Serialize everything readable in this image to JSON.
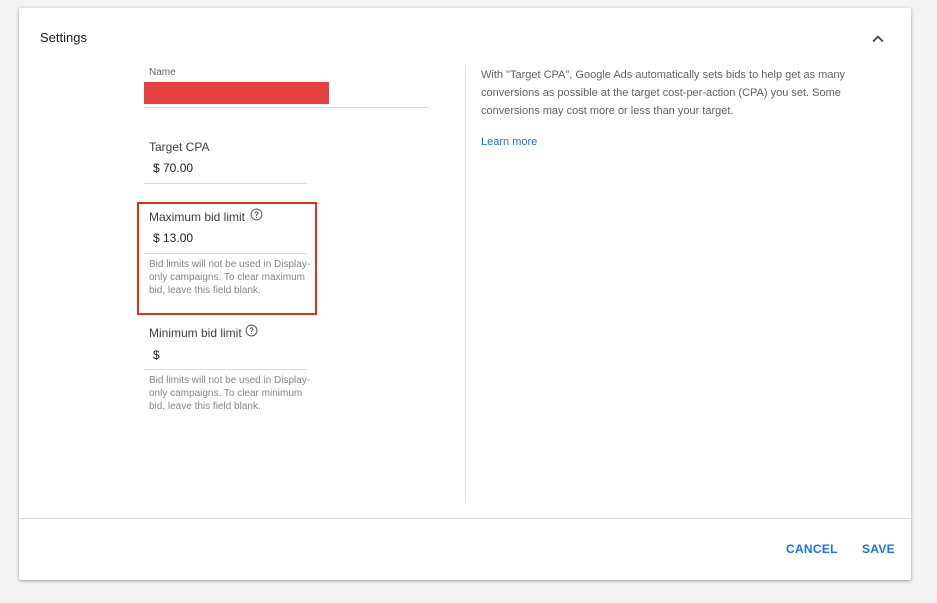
{
  "header": {
    "title": "Settings",
    "collapse_icon": "chevron-up-icon"
  },
  "form": {
    "name": {
      "label": "Name",
      "value_redacted": true
    },
    "target_cpa": {
      "label": "Target CPA",
      "value": "$ 70.00"
    },
    "max_bid": {
      "label": "Maximum bid limit",
      "value": "$ 13.00",
      "helper": "Bid limits will not be used in Display-only campaigns. To clear maximum bid, leave this field blank.",
      "help_icon": "help-circle-icon",
      "highlighted": true
    },
    "min_bid": {
      "label": "Minimum bid limit",
      "value": "$",
      "helper": "Bid limits will not be used in Display-only campaigns. To clear minimum bid, leave this field blank.",
      "help_icon": "help-circle-icon"
    }
  },
  "info": {
    "description": "With \"Target CPA\", Google Ads automatically sets bids to help get as many conversions as possible at the target cost-per-action (CPA) you set. Some conversions may cost more or less than your target.",
    "learn_more": "Learn more"
  },
  "footer": {
    "cancel_label": "CANCEL",
    "save_label": "SAVE"
  },
  "colors": {
    "accent": "#1a73e8",
    "highlight_border": "#e0301e",
    "redaction": "#e53f3f"
  }
}
